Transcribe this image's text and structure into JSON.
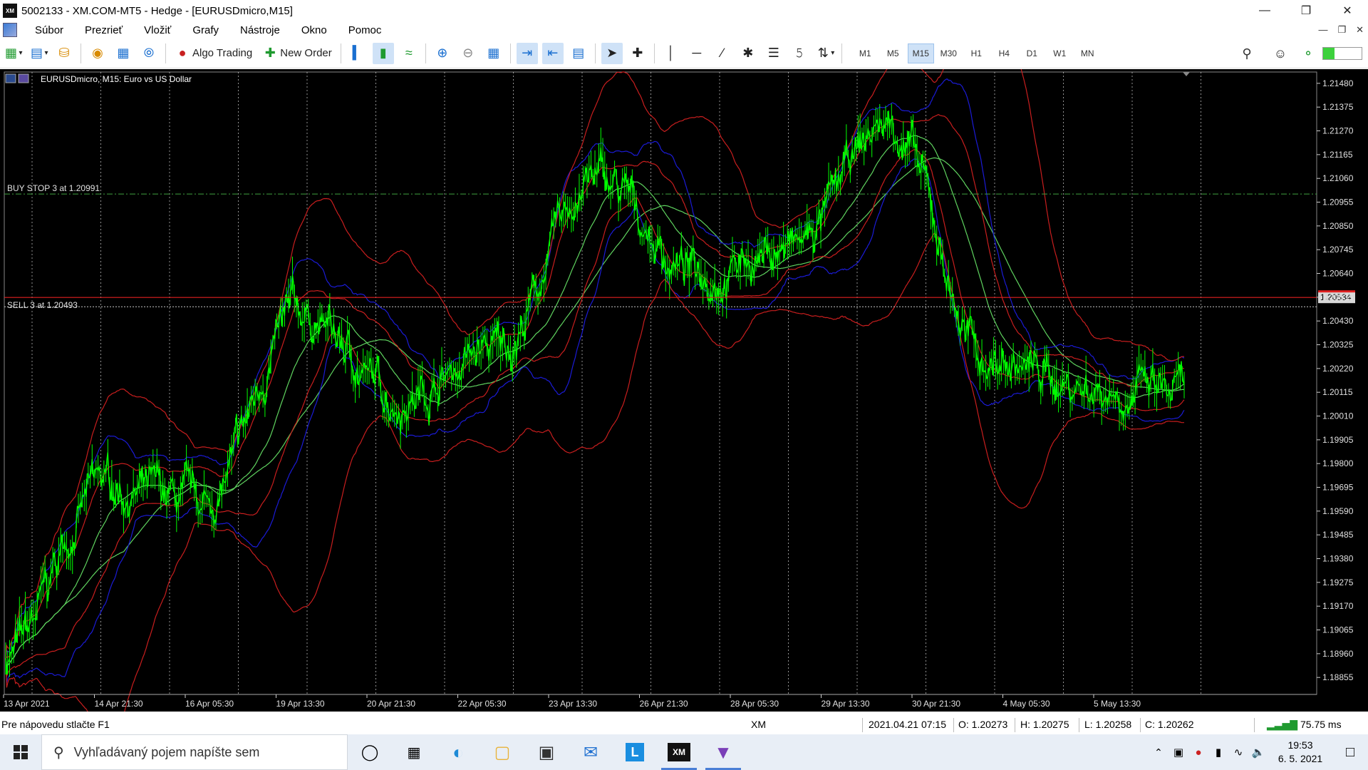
{
  "window": {
    "title": "5002133 - XM.COM-MT5 - Hedge - [EURUSDmicro,M15]",
    "app_icon_label": "XM"
  },
  "menu": {
    "items": [
      "Súbor",
      "Prezrieť",
      "Vložiť",
      "Grafy",
      "Nástroje",
      "Okno",
      "Pomoc"
    ]
  },
  "toolbar": {
    "algo_trading_label": "Algo Trading",
    "new_order_label": "New Order",
    "timeframes": [
      "M1",
      "M5",
      "M15",
      "M30",
      "H1",
      "H4",
      "D1",
      "W1",
      "MN"
    ],
    "active_timeframe": "M15"
  },
  "chart": {
    "symbol_label": "EURUSDmicro, M15:  Euro vs US Dollar",
    "buy_stop_label": "BUY STOP 3 at 1.20991",
    "sell_label": "SELL 3 at 1.20493",
    "current_price_label": "1.20534",
    "price_ticks": [
      "1.21480",
      "1.21375",
      "1.21270",
      "1.21165",
      "1.21060",
      "1.20955",
      "1.20850",
      "1.20745",
      "1.20640",
      "1.20535",
      "1.20430",
      "1.20325",
      "1.20220",
      "1.20115",
      "1.20010",
      "1.19905",
      "1.19800",
      "1.19695",
      "1.19590",
      "1.19485",
      "1.19380",
      "1.19275",
      "1.19170",
      "1.19065",
      "1.18960",
      "1.18855"
    ],
    "time_ticks": [
      "13 Apr 2021",
      "14 Apr 21:30",
      "16 Apr 05:30",
      "19 Apr 13:30",
      "20 Apr 21:30",
      "22 Apr 05:30",
      "23 Apr 13:30",
      "26 Apr 21:30",
      "28 Apr 05:30",
      "29 Apr 13:30",
      "30 Apr 21:30",
      "4 May 05:30",
      "5 May 13:30"
    ],
    "colors": {
      "price": "#00ff00",
      "band_red": "#c81e1e",
      "band_blue": "#1b1bd6",
      "ma_green": "#5fd35f",
      "grid": "#cfcfcf"
    }
  },
  "chart_data": {
    "type": "line",
    "symbol": "EURUSDmicro",
    "timeframe": "M15",
    "ylim": [
      1.1878,
      1.2153
    ],
    "x": [
      "13 Apr 2021",
      "14 Apr 21:30",
      "16 Apr 05:30",
      "19 Apr 13:30",
      "20 Apr 21:30",
      "22 Apr 05:30",
      "23 Apr 13:30",
      "26 Apr 21:30",
      "28 Apr 05:30",
      "29 Apr 13:30",
      "30 Apr 21:30",
      "4 May 05:30",
      "5 May 13:30"
    ],
    "series": [
      {
        "values": [
          1.1895,
          1.197,
          1.196,
          1.2045,
          1.201,
          1.203,
          1.2105,
          1.2065,
          1.2075,
          1.213,
          1.2025,
          1.2015,
          1.201
        ]
      },
      {
        "values": [
          1.195,
          1.1995,
          1.198,
          1.206,
          1.204,
          1.204,
          1.2095,
          1.2085,
          1.2085,
          1.21,
          1.204,
          1.203,
          1.2045
        ]
      },
      {
        "values": [
          1.19,
          1.1945,
          1.193,
          1.2005,
          1.1995,
          1.1985,
          1.204,
          1.2055,
          1.205,
          1.207,
          1.201,
          1.2,
          1.202
        ]
      }
    ],
    "levels": [
      {
        "value": 1.20991
      },
      {
        "value": 1.20493
      },
      {
        "value": 1.20534
      }
    ]
  },
  "status": {
    "help_text": "Pre nápovedu stlačte F1",
    "broker": "XM",
    "datetime": "2021.04.21 07:15",
    "open": "O: 1.20273",
    "high": "H: 1.20275",
    "low": "L: 1.20258",
    "close": "C: 1.20262",
    "ping": "75.75 ms"
  },
  "taskbar": {
    "search_placeholder": "Vyhľadávaný pojem napíšte sem",
    "time": "19:53",
    "date": "6. 5. 2021"
  }
}
